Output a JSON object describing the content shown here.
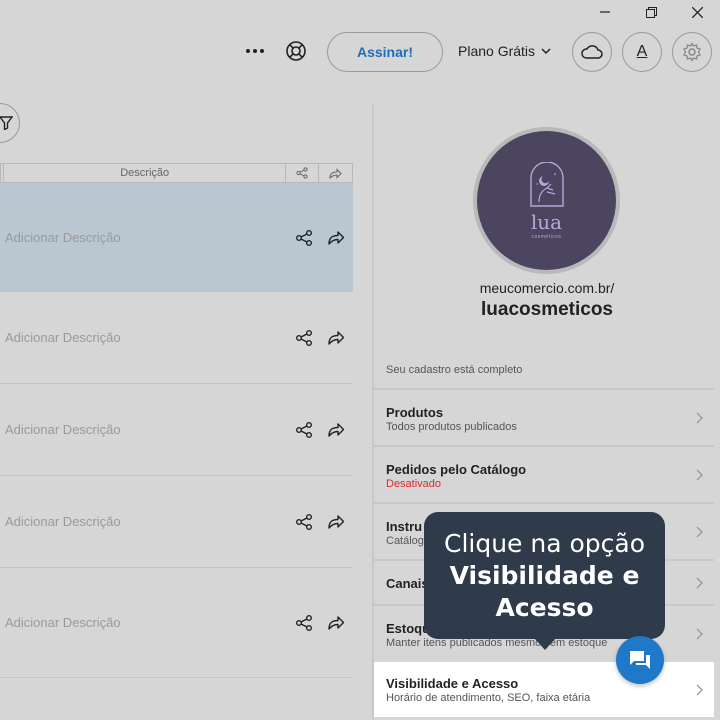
{
  "toolbar": {
    "subscribe_label": "Assinar!",
    "plan_label": "Plano Grátis",
    "account_letter": "A"
  },
  "table": {
    "header_description": "Descrição",
    "rows": [
      {
        "description": "Adicionar Descrição"
      },
      {
        "description": "Adicionar Descrição"
      },
      {
        "description": "Adicionar Descrição"
      },
      {
        "description": "Adicionar Descrição"
      },
      {
        "description": "Adicionar Descrição"
      }
    ]
  },
  "profile": {
    "url": "meucomercio.com.br/",
    "handle": "luacosmeticos",
    "logo_text": "lua",
    "logo_sub": "cosméticos"
  },
  "status": {
    "text": "Seu cadastro está completo"
  },
  "menu": [
    {
      "title": "Produtos",
      "subtitle": "Todos produtos publicados",
      "alert": false
    },
    {
      "title": "Pedidos pelo Catálogo",
      "subtitle": "Desativado",
      "alert": true
    },
    {
      "title": "Instru",
      "subtitle": "Catálog",
      "alert": false
    },
    {
      "title": "Canais",
      "subtitle": "",
      "alert": false
    },
    {
      "title": "Estoque",
      "subtitle": "Manter itens publicados mesmo sem estoque",
      "alert": false
    },
    {
      "title": "Visibilidade e Acesso",
      "subtitle": "Horário de atendimento, SEO, faixa etária",
      "alert": false
    }
  ],
  "tooltip": {
    "line1": "Clique na opção",
    "line2": "Visibilidade e",
    "line3": "Acesso"
  },
  "colors": {
    "accent": "#1f6fb8",
    "selected_row": "#bac7d1",
    "tooltip_bg": "#2f3b4a",
    "alert": "#e02828",
    "chat_button": "#1f78c8"
  }
}
